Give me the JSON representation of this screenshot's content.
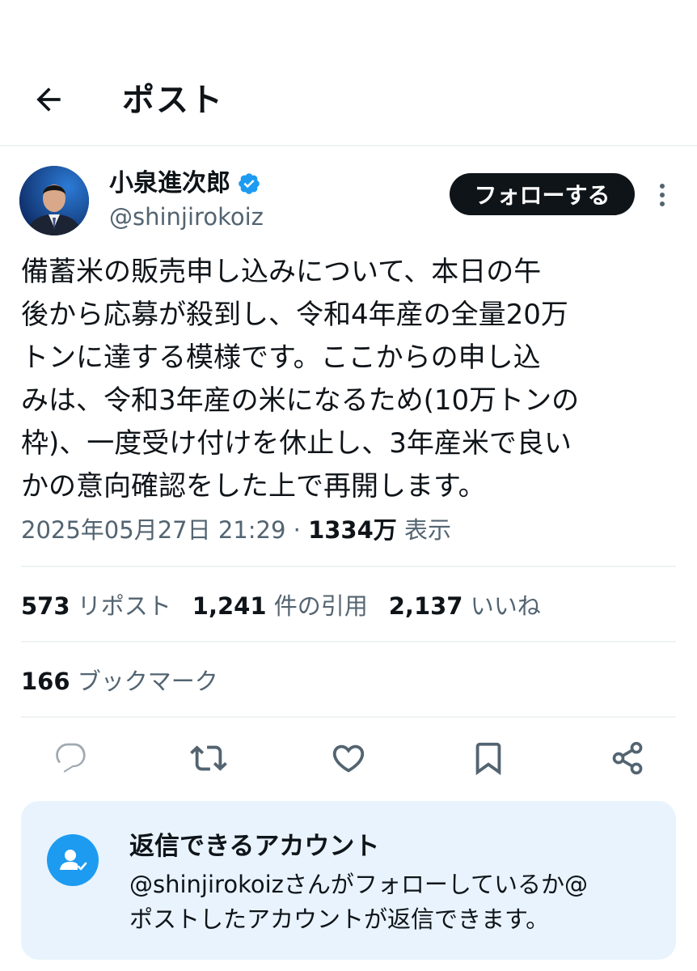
{
  "header": {
    "title": "ポスト",
    "back_icon": "arrow-left-icon"
  },
  "author": {
    "display_name": "小泉進次郎",
    "handle": "@shinjirokoiz",
    "verified": true,
    "verified_color": "#1d9bf0",
    "follow_label": "フォローする"
  },
  "post": {
    "lines": [
      "備蓄米の販売申し込みについて、本日の午",
      "後から応募が殺到し、令和4年産の全量20万",
      "トンに達する模様です。ここからの申し込",
      "みは、令和3年産の米になるため(10万トンの",
      "枠)、一度受け付けを休止し、3年産米で良い",
      "かの意向確認をした上で再開します。"
    ],
    "timestamp": "2025年05月27日 21:29",
    "separator": "·",
    "views": "1334万",
    "views_label": "表示"
  },
  "stats": {
    "reposts": "573",
    "reposts_label": "リポスト",
    "quotes": "1,241",
    "quotes_label": "件の引用",
    "likes": "2,137",
    "likes_label": "いいね",
    "bookmarks": "166",
    "bookmarks_label": "ブックマーク"
  },
  "actions": [
    "reply-icon",
    "repost-icon",
    "like-icon",
    "bookmark-icon",
    "share-icon"
  ],
  "reply_restriction": {
    "title": "返信できるアカウント",
    "line1": "@shinjirokoizさんがフォローしているか@",
    "line2": "ポストしたアカウントが返信できます。"
  },
  "colors": {
    "accent": "#1d9bf0",
    "text": "#0f1419",
    "muted": "#536471",
    "notice_bg": "#e8f3fd"
  }
}
